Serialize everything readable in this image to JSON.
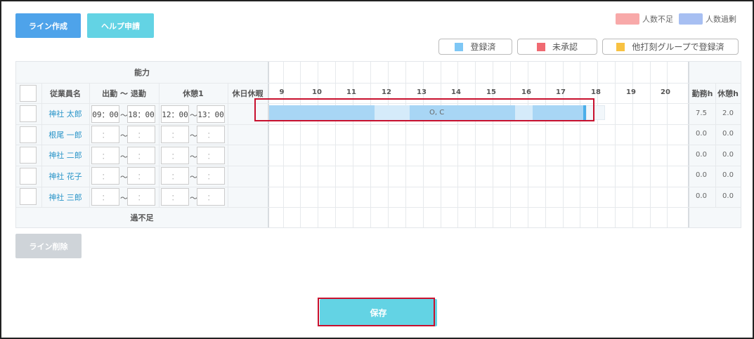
{
  "buttons": {
    "line_create": "ライン作成",
    "help_request": "ヘルプ申請",
    "line_delete": "ライン削除",
    "save": "保存"
  },
  "legend": {
    "shortage": {
      "label": "人数不足",
      "color": "#f8a9a9"
    },
    "surplus": {
      "label": "人数過剰",
      "color": "#a7bff2"
    }
  },
  "status_legend": [
    {
      "label": "登録済",
      "color": "#7ec7f5"
    },
    {
      "label": "未承認",
      "color": "#f06a72"
    },
    {
      "label": "他打刻グループで登録済",
      "color": "#f8c242"
    }
  ],
  "table": {
    "ability_header": "能力",
    "headers": {
      "employee": "従業員名",
      "shift": "出勤 〜 退勤",
      "break": "休憩1",
      "holiday": "休日休暇",
      "work_h": "勤務h",
      "break_h": "休憩h"
    },
    "hours": [
      "9",
      "10",
      "11",
      "12",
      "13",
      "14",
      "15",
      "16",
      "17",
      "18",
      "19",
      "20"
    ],
    "rows": [
      {
        "name": "神社 太郎",
        "start": "09：00",
        "end": "18：00",
        "bstart": "12：00",
        "bend": "13：00",
        "work_h": "7.5",
        "break_h": "2.0"
      },
      {
        "name": "根尾 一郎",
        "start": "：",
        "end": "：",
        "bstart": "：",
        "bend": "：",
        "work_h": "0.0",
        "break_h": "0.0"
      },
      {
        "name": "神社 二郎",
        "start": "：",
        "end": "：",
        "bstart": "：",
        "bend": "：",
        "work_h": "0.0",
        "break_h": "0.0"
      },
      {
        "name": "神社 花子",
        "start": "：",
        "end": "：",
        "bstart": "：",
        "bend": "：",
        "work_h": "0.0",
        "break_h": "0.0"
      },
      {
        "name": "神社 三郎",
        "start": "：",
        "end": "：",
        "bstart": "：",
        "bend": "：",
        "work_h": "0.0",
        "break_h": "0.0"
      }
    ],
    "shift_bar_label": "O, C",
    "footer": "過不足"
  },
  "tilde": "〜"
}
